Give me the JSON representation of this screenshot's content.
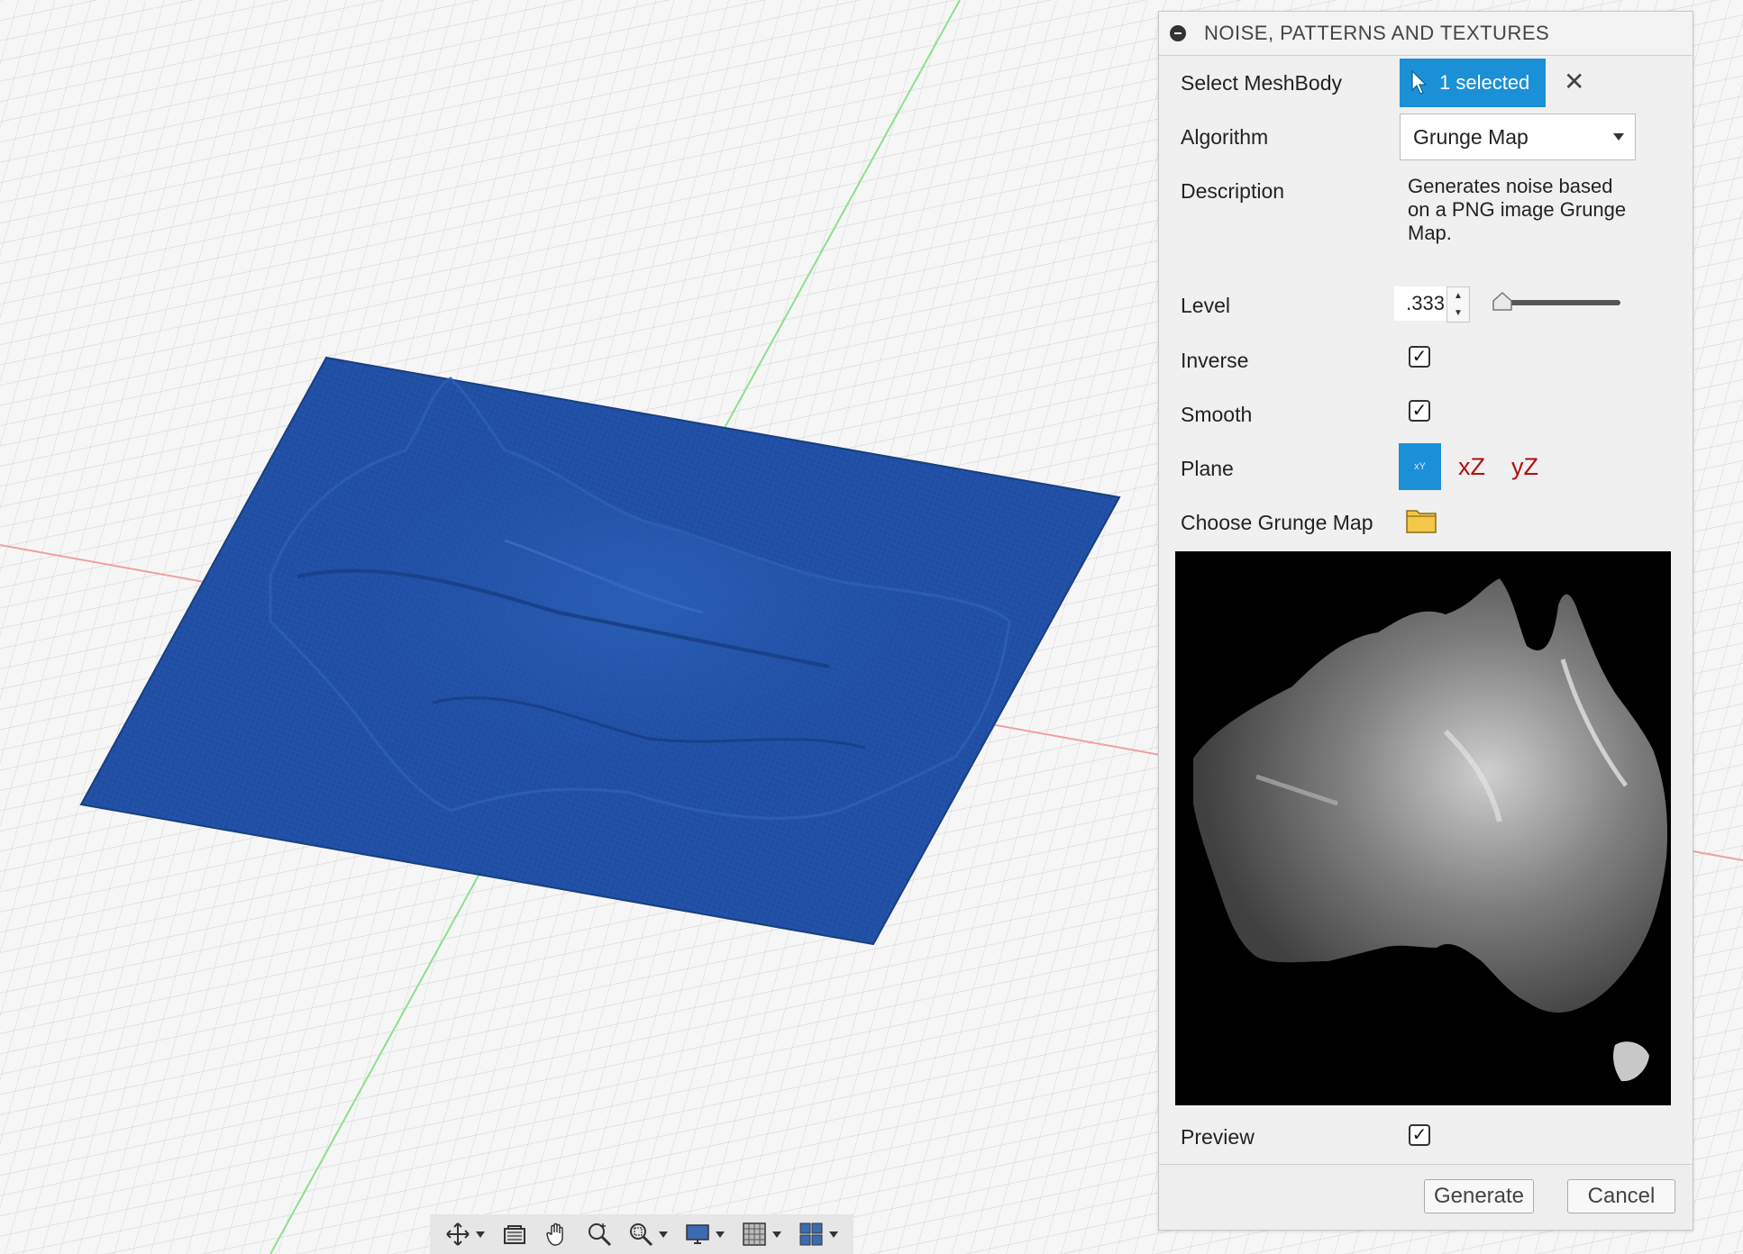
{
  "dialog": {
    "title": "NOISE, PATTERNS AND TEXTURES",
    "select_meshbody": {
      "label": "Select MeshBody",
      "value": "1 selected",
      "icon": "cursor-arrow-icon"
    },
    "algorithm": {
      "label": "Algorithm",
      "value": "Grunge Map"
    },
    "description": {
      "label": "Description",
      "value": "Generates noise based on a PNG image Grunge Map."
    },
    "level": {
      "label": "Level",
      "value": ".333",
      "slider_fraction": 0.05
    },
    "inverse": {
      "label": "Inverse",
      "checked": true
    },
    "smooth": {
      "label": "Smooth",
      "checked": true
    },
    "plane": {
      "label": "Plane",
      "options": [
        "xY",
        "xZ",
        "yZ"
      ],
      "selected": "xY"
    },
    "grunge_map": {
      "label": "Choose Grunge Map",
      "icon": "folder-icon"
    },
    "preview": {
      "label": "Preview",
      "checked": true
    },
    "buttons": {
      "generate": "Generate",
      "cancel": "Cancel"
    }
  },
  "toolbar": {
    "items": [
      "orbit-icon",
      "look-at-icon",
      "pan-icon",
      "zoom-icon",
      "fit-icon",
      "display-settings-icon",
      "grid-settings-icon",
      "viewports-icon"
    ]
  },
  "colors": {
    "accent": "#1b90d6",
    "mesh": "#1f4ea3",
    "plane_option": "#b01010"
  }
}
